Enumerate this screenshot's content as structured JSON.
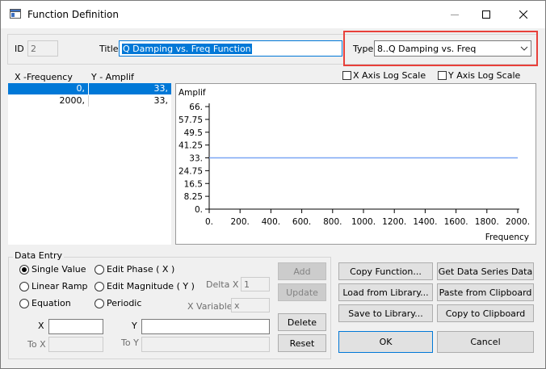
{
  "window": {
    "title": "Function Definition"
  },
  "header": {
    "id_label": "ID",
    "id_value": "2",
    "title_label": "Title",
    "title_value": "Q Damping vs. Freq Function",
    "type_label": "Type",
    "type_value": "8..Q Damping vs. Freq"
  },
  "table": {
    "col_x": "X -Frequency",
    "col_y": "Y - Amplif",
    "rows": [
      {
        "x": "0,",
        "y": "33,"
      },
      {
        "x": "2000,",
        "y": "33,"
      }
    ]
  },
  "options": {
    "x_log": "X Axis Log Scale",
    "y_log": "Y Axis Log Scale"
  },
  "chart_data": {
    "type": "line",
    "ylabel": "Amplif",
    "xlabel": "Frequency",
    "xlim": [
      0,
      2000
    ],
    "ylim": [
      0,
      66
    ],
    "x_ticks": [
      "0.",
      "200.",
      "400.",
      "600.",
      "800.",
      "1000.",
      "1200.",
      "1400.",
      "1600.",
      "1800.",
      "2000."
    ],
    "y_ticks": [
      "66.",
      "57.75",
      "49.5",
      "41.25",
      "33.",
      "24.75",
      "16.5",
      "8.25",
      "0."
    ],
    "x": [
      0,
      2000
    ],
    "series": [
      {
        "values": [
          33,
          33
        ],
        "color": "#7aa6f4"
      }
    ]
  },
  "data_entry": {
    "group_label": "Data Entry",
    "single_value": "Single Value",
    "linear_ramp": "Linear Ramp",
    "equation": "Equation",
    "edit_phase": "Edit Phase ( X )",
    "edit_magnitude": "Edit Magnitude ( Y )",
    "periodic": "Periodic",
    "delta_x_label": "Delta X",
    "delta_x_value": "1",
    "x_variable_label": "X Variable",
    "x_variable_value": "x",
    "x_label": "X",
    "y_label": "Y",
    "to_x_label": "To X",
    "to_y_label": "To Y",
    "x_value": "",
    "y_value": ""
  },
  "buttons": {
    "add": "Add",
    "update": "Update",
    "delete": "Delete",
    "reset": "Reset",
    "copy_function": "Copy Function...",
    "get_series": "Get Data Series Data",
    "load_library": "Load from Library...",
    "paste_clipboard": "Paste from Clipboard",
    "save_library": "Save to Library...",
    "copy_clipboard": "Copy to Clipboard",
    "ok": "OK",
    "cancel": "Cancel"
  },
  "colors": {
    "accent": "#0078d7",
    "highlight": "#e8403a",
    "series": "#7aa6f4"
  }
}
